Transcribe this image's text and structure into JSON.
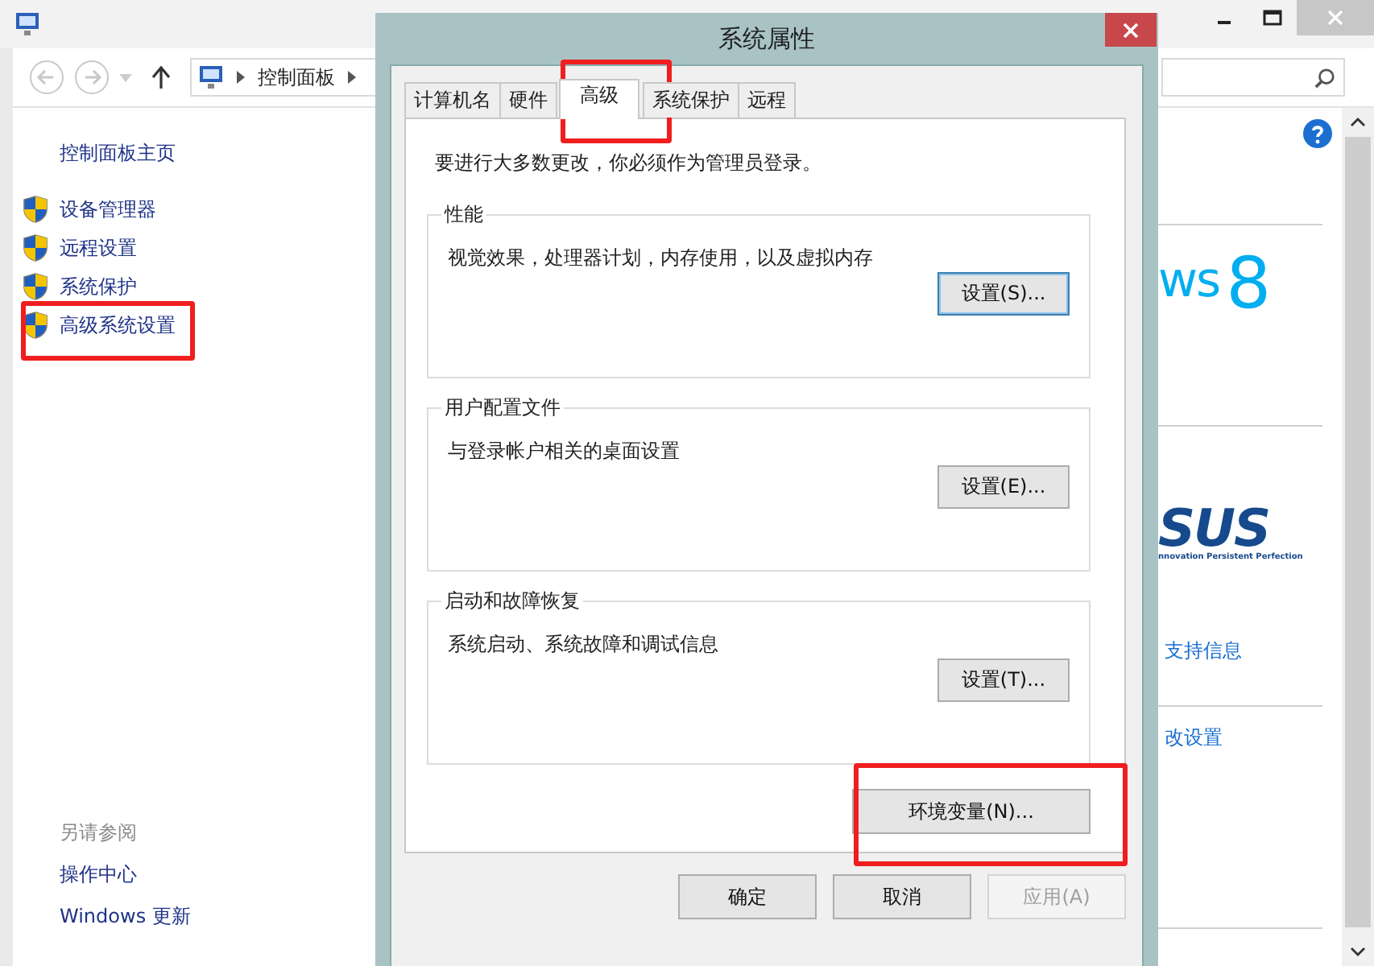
{
  "window": {
    "address": "控制面板"
  },
  "left_pane": {
    "home_link": "控制面板主页",
    "tasks": [
      {
        "label": "设备管理器"
      },
      {
        "label": "远程设置"
      },
      {
        "label": "系统保护"
      },
      {
        "label": "高级系统设置"
      }
    ],
    "see_also": {
      "heading": "另请参阅",
      "links": [
        "操作中心",
        "Windows 更新"
      ]
    }
  },
  "right_fragments": {
    "os_logo": [
      "ws",
      "8"
    ],
    "oem_logo": {
      "mark": "SUS",
      "tagline": "nnovation  Persistent Perfection"
    },
    "links": [
      "支持信息",
      "改设置"
    ]
  },
  "dialog": {
    "title": "系统属性",
    "tabs": [
      {
        "label": "计算机名",
        "selected": false
      },
      {
        "label": "硬件",
        "selected": false
      },
      {
        "label": "高级",
        "selected": true
      },
      {
        "label": "系统保护",
        "selected": false
      },
      {
        "label": "远程",
        "selected": false
      }
    ],
    "notice": "要进行大多数更改，你必须作为管理员登录。",
    "groups": [
      {
        "title": "性能",
        "description": "视觉效果，处理器计划，内存使用，以及虚拟内存",
        "button": {
          "label": "设置(S)...",
          "focused": true
        }
      },
      {
        "title": "用户配置文件",
        "description": "与登录帐户相关的桌面设置",
        "button": {
          "label": "设置(E)...",
          "focused": false
        }
      },
      {
        "title": "启动和故障恢复",
        "description": "系统启动、系统故障和调试信息",
        "button": {
          "label": "设置(T)...",
          "focused": false
        }
      }
    ],
    "env_button": "环境变量(N)...",
    "buttons": [
      {
        "label": "确定",
        "disabled": false
      },
      {
        "label": "取消",
        "disabled": false
      },
      {
        "label": "应用(A)",
        "disabled": true
      }
    ]
  }
}
